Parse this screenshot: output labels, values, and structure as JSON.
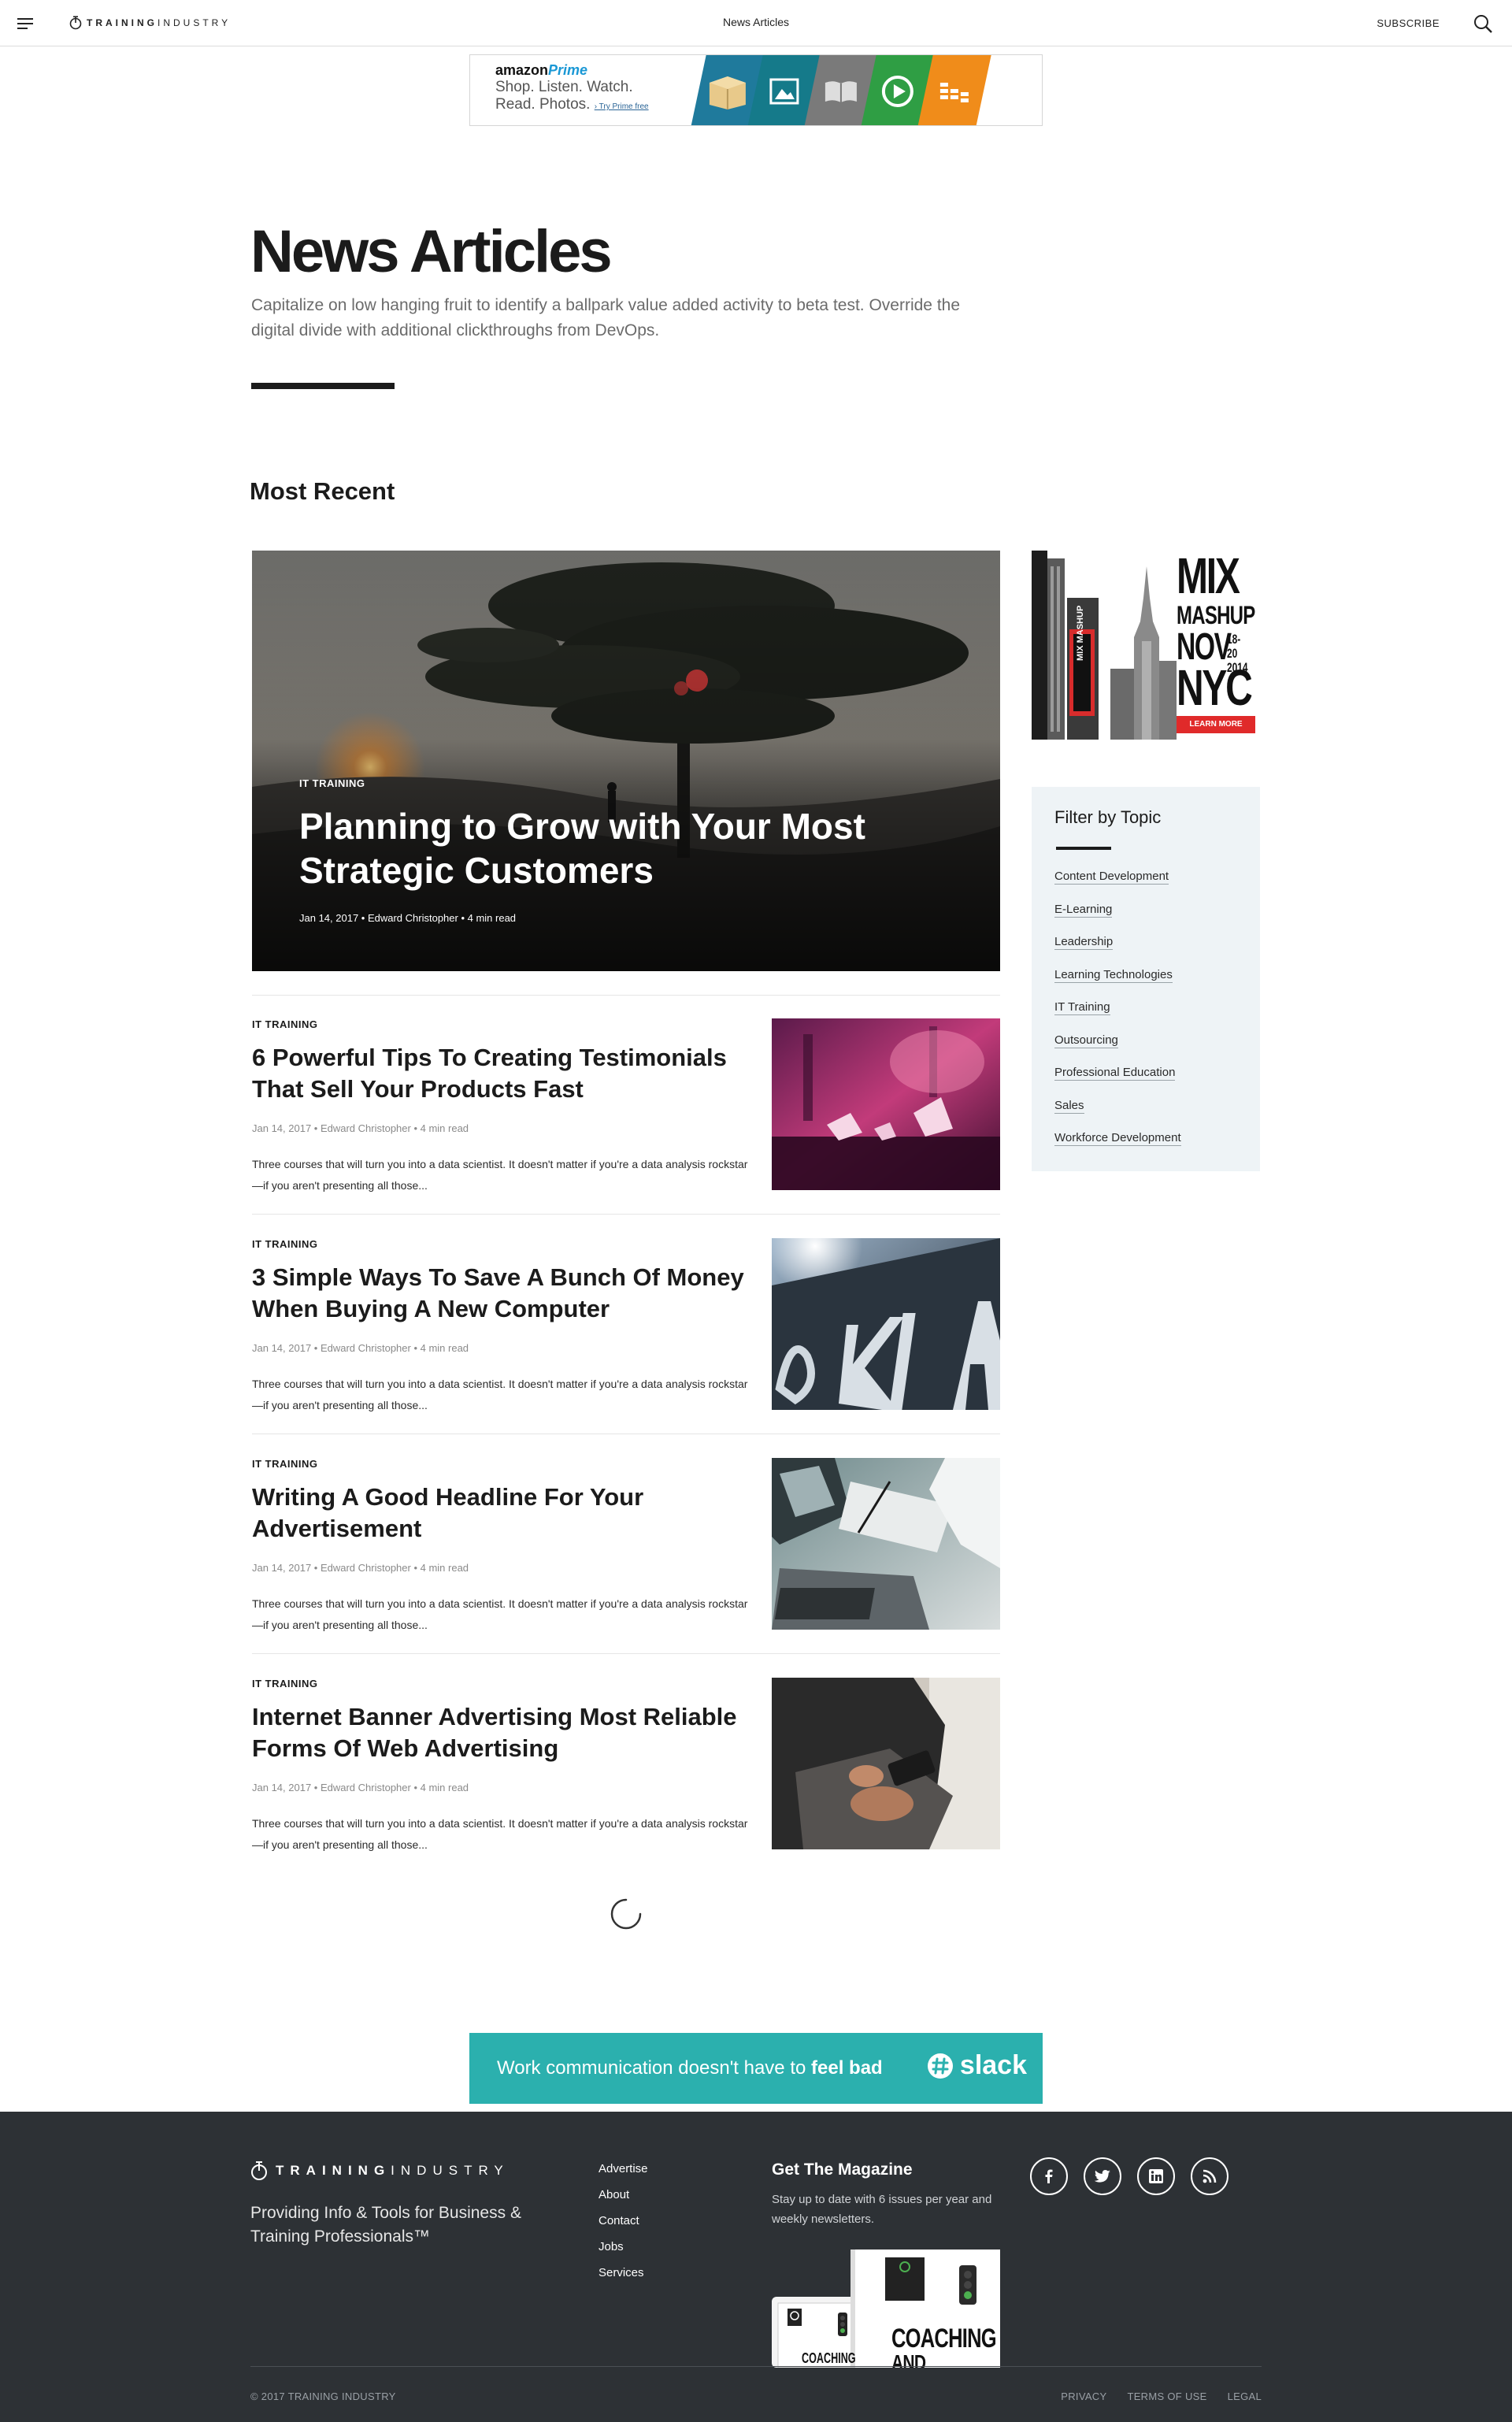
{
  "header": {
    "logo_bold": "TRAINING",
    "logo_light": "INDUSTRY",
    "title": "News Articles",
    "subscribe": "SUBSCRIBE"
  },
  "amazon_ad": {
    "brand": "amazon",
    "brand_accent": "Prime",
    "line1": "Shop. Listen. Watch.",
    "line2": "Read. Photos.",
    "try_link": "› Try Prime free",
    "panel_colors": [
      "#1f7a9c",
      "#157a8a",
      "#7a7a7a",
      "#2f9e44",
      "#f08c1a"
    ]
  },
  "hero": {
    "title": "News Articles",
    "description": "Capitalize on low hanging fruit to identify a ballpark value added activity to beta test. Override the digital divide with additional clickthroughs from DevOps."
  },
  "section_title": "Most Recent",
  "featured": {
    "category": "IT TRAINING",
    "title": "Planning to Grow with Your Most Strategic Customers",
    "meta": "Jan 14, 2017 • Edward Christopher • 4 min read"
  },
  "articles": [
    {
      "category": "IT TRAINING",
      "title": "6 Powerful Tips To Creating Testimonials That Sell Your Products Fast",
      "meta": "Jan 14, 2017 • Edward Christopher • 4 min read",
      "excerpt": "Three courses that will turn you into a data scientist. It doesn't matter if you're a data analysis rockstar—if you aren't presenting all those..."
    },
    {
      "category": "IT TRAINING",
      "title": "3 Simple Ways To Save A Bunch Of Money When Buying A New Computer",
      "meta": "Jan 14, 2017 • Edward Christopher • 4 min read",
      "excerpt": "Three courses that will turn you into a data scientist. It doesn't matter if you're a data analysis rockstar—if you aren't presenting all those..."
    },
    {
      "category": "IT TRAINING",
      "title": "Writing A Good Headline For Your Advertisement",
      "meta": "Jan 14, 2017 • Edward Christopher • 4 min read",
      "excerpt": "Three courses that will turn you into a data scientist. It doesn't matter if you're a data analysis rockstar—if you aren't presenting all those..."
    },
    {
      "category": "IT TRAINING",
      "title": "Internet Banner Advertising Most Reliable Forms Of Web Advertising",
      "meta": "Jan 14, 2017 • Edward Christopher • 4 min read",
      "excerpt": "Three courses that will turn you into a data scientist. It doesn't matter if you're a data analysis rockstar—if you aren't presenting all those..."
    }
  ],
  "mix_ad": {
    "line1": "MIX",
    "line2": "MASHUP",
    "line3": "NOV",
    "dates": "18-20",
    "year": "2014",
    "line4": "NYC",
    "cta": "LEARN MORE",
    "sign": "MIX MASHUP"
  },
  "filter": {
    "title": "Filter by Topic",
    "topics": [
      "Content Development",
      "E-Learning",
      "Leadership",
      "Learning Technologies",
      "IT Training",
      "Outsourcing",
      "Professional Education",
      "Sales",
      "Workforce Development"
    ]
  },
  "slack_ad": {
    "text": "Work communication doesn't have to",
    "text_bold": "feel bad",
    "logo": "slack"
  },
  "footer": {
    "logo_bold": "TRAINING",
    "logo_light": "INDUSTRY",
    "tagline": "Providing Info & Tools for Business & Training Professionals™",
    "nav": [
      "Advertise",
      "About",
      "Contact",
      "Jobs",
      "Services"
    ],
    "magazine_title": "Get The Magazine",
    "magazine_desc": "Stay up to date with 6 issues per year and weekly newsletters.",
    "magazine_cover_text": "COACHING",
    "magazine_cover_text2": "AND CULTURE",
    "magazine_small": "COACHING",
    "socials": [
      "facebook-icon",
      "twitter-icon",
      "linkedin-icon",
      "rss-icon"
    ],
    "copyright": "© 2017 TRAINING INDUSTRY",
    "legal": [
      "PRIVACY",
      "TERMS OF USE",
      "LEGAL"
    ]
  }
}
